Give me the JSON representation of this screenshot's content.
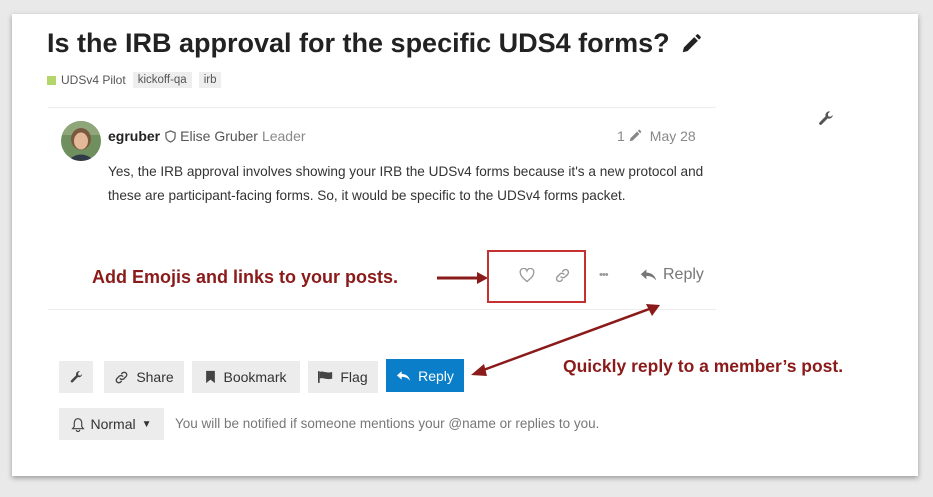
{
  "topic": {
    "title": "Is the IRB approval for the specific UDS4 forms?",
    "category": "UDSv4 Pilot",
    "tags": [
      "kickoff-qa",
      "irb"
    ]
  },
  "post": {
    "username": "egruber",
    "full_name": "Elise Gruber",
    "role": "Leader",
    "edit_count": "1",
    "date": "May 28",
    "body": "Yes, the IRB approval involves showing your IRB the UDSv4 forms because it's a new protocol and these are participant-facing forms. So, it would be specific to the UDSv4 forms packet.",
    "more_label": "•••",
    "reply_label": "Reply"
  },
  "annotations": {
    "emoji_note": "Add Emojis and links to your posts.",
    "reply_note": "Quickly reply to a member’s post."
  },
  "footer_buttons": {
    "share": "Share",
    "bookmark": "Bookmark",
    "flag": "Flag",
    "reply": "Reply"
  },
  "notification": {
    "level": "Normal",
    "description": "You will be notified if someone mentions your @name or replies to you."
  },
  "colors": {
    "annotation": "#8b1a1a",
    "highlight_box": "#c53030",
    "primary": "#0a7ec8",
    "category": "#b3d66a"
  }
}
